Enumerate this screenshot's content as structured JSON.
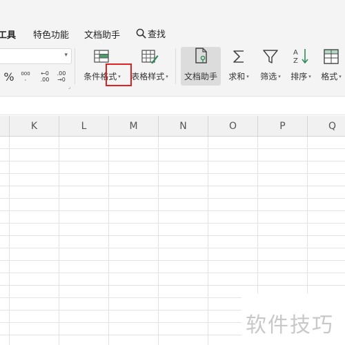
{
  "menubar": {
    "items": [
      {
        "label": "工具"
      },
      {
        "label": "特色功能"
      },
      {
        "label": "文档助手"
      }
    ],
    "search_label": "查找"
  },
  "ribbon": {
    "number_format": {
      "percent": "%",
      "thousands": "000",
      "thousands_sub": ",",
      "inc_decimal_top": "←0",
      "inc_decimal_bottom": ".00",
      "dec_decimal_top": ".00",
      "dec_decimal_bottom": "→0"
    },
    "buttons": [
      {
        "label": "条件格式",
        "has_dropdown": true,
        "icon": "conditional-format-icon"
      },
      {
        "label": "表格样式",
        "has_dropdown": true,
        "icon": "table-style-icon"
      },
      {
        "label": "文档助手",
        "has_dropdown": false,
        "icon": "doc-assistant-icon",
        "active": true
      },
      {
        "label": "求和",
        "has_dropdown": true,
        "icon": "sum-icon"
      },
      {
        "label": "筛选",
        "has_dropdown": true,
        "icon": "filter-icon"
      },
      {
        "label": "排序",
        "has_dropdown": true,
        "icon": "sort-icon"
      },
      {
        "label": "格式",
        "has_dropdown": true,
        "icon": "format-icon"
      }
    ],
    "dropdown_glyph": "▾"
  },
  "sheet": {
    "columns": [
      "K",
      "L",
      "M",
      "N",
      "O",
      "P",
      "Q"
    ]
  },
  "watermark": "软件技巧",
  "colors": {
    "chrome_bg": "#f4f4f4",
    "header_bg": "#f1f1f1",
    "gridline": "#e3e3e3",
    "highlight": "#e02020",
    "active_button": "#dcdcdc",
    "icon_green": "#2e8b57"
  }
}
